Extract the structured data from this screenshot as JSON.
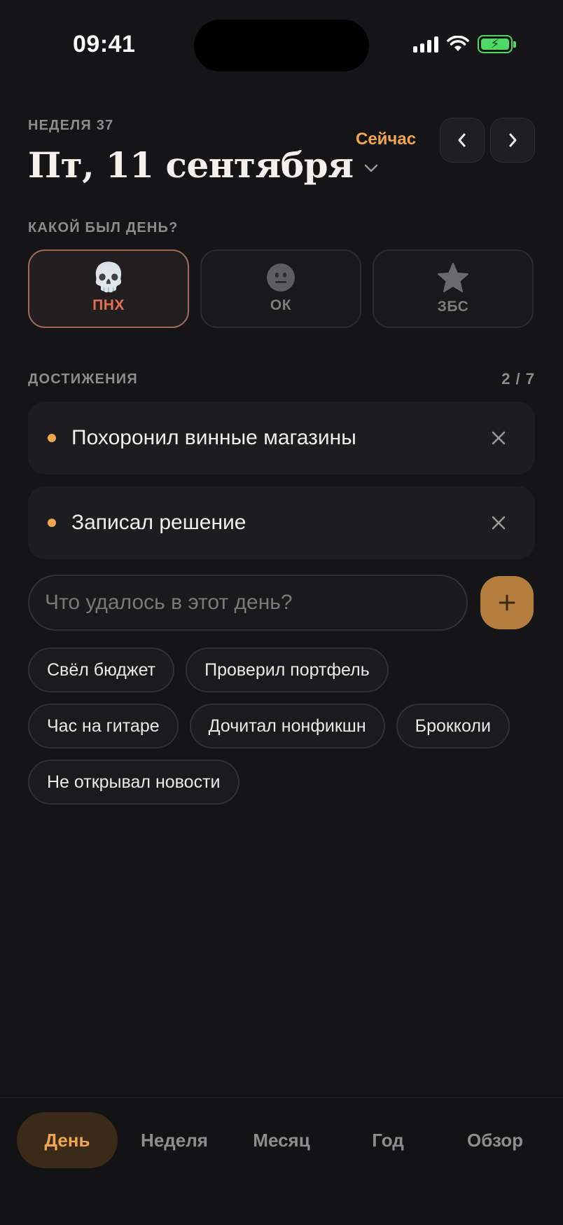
{
  "status_bar": {
    "time": "09:41"
  },
  "header": {
    "week_label": "НЕДЕЛЯ 37",
    "date_title": "Пт, 11 сентября",
    "now_label": "Сейчас",
    "prev_icon": "chevron-left-icon",
    "next_icon": "chevron-right-icon"
  },
  "mood": {
    "section_label": "КАКОЙ БЫЛ ДЕНЬ?",
    "options": [
      {
        "label": "ПНХ",
        "icon": "skull-icon",
        "glyph": "💀",
        "selected": true
      },
      {
        "label": "ОК",
        "icon": "neutral-face-icon",
        "selected": false
      },
      {
        "label": "ЗБС",
        "icon": "star-icon",
        "glyph": "★",
        "selected": false
      }
    ],
    "accent_color": "#e2704f"
  },
  "achievements": {
    "section_label": "ДОСТИЖЕНИЯ",
    "counter": "2 / 7",
    "items": [
      {
        "text": "Похоронил винные магазины"
      },
      {
        "text": "Записал решение"
      }
    ],
    "input_placeholder": "Что удалось в этот день?",
    "add_icon": "plus-icon",
    "suggestions": [
      "Свёл бюджет",
      "Проверил портфель",
      "Час на гитаре",
      "Дочитал нонфикшн",
      "Брокколи",
      "Не открывал новости"
    ]
  },
  "tabs": [
    {
      "label": "День",
      "active": true
    },
    {
      "label": "Неделя",
      "active": false
    },
    {
      "label": "Месяц",
      "active": false
    },
    {
      "label": "Год",
      "active": false
    },
    {
      "label": "Обзор",
      "active": false
    }
  ],
  "colors": {
    "accent": "#f0a64e",
    "background": "#151517",
    "battery": "#4cd964"
  }
}
